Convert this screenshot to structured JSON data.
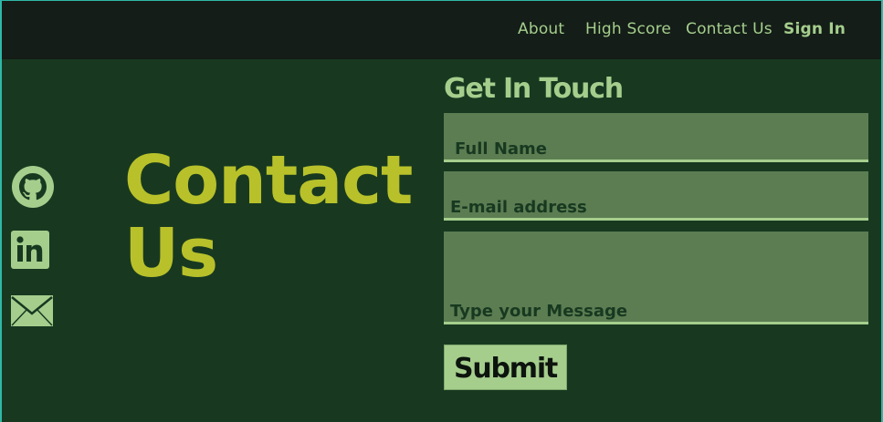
{
  "nav": {
    "about": "About",
    "high_score": "High Score",
    "contact_us": "Contact Us",
    "sign_in": "Sign In"
  },
  "social": {
    "icons": [
      "github-icon",
      "linkedin-icon",
      "mail-icon"
    ]
  },
  "hero": {
    "line1": "Contact",
    "line2": "Us"
  },
  "form": {
    "heading": "Get In Touch",
    "full_name_placeholder": "Full Name",
    "email_placeholder": "E-mail address",
    "message_placeholder": "Type your Message",
    "submit_label": "Submit"
  },
  "colors": {
    "background": "#183920",
    "navbar": "#141d17",
    "accent_light": "#a5ce8d",
    "hero_title": "#b8c12a",
    "field_bg": "#5c7d52"
  }
}
